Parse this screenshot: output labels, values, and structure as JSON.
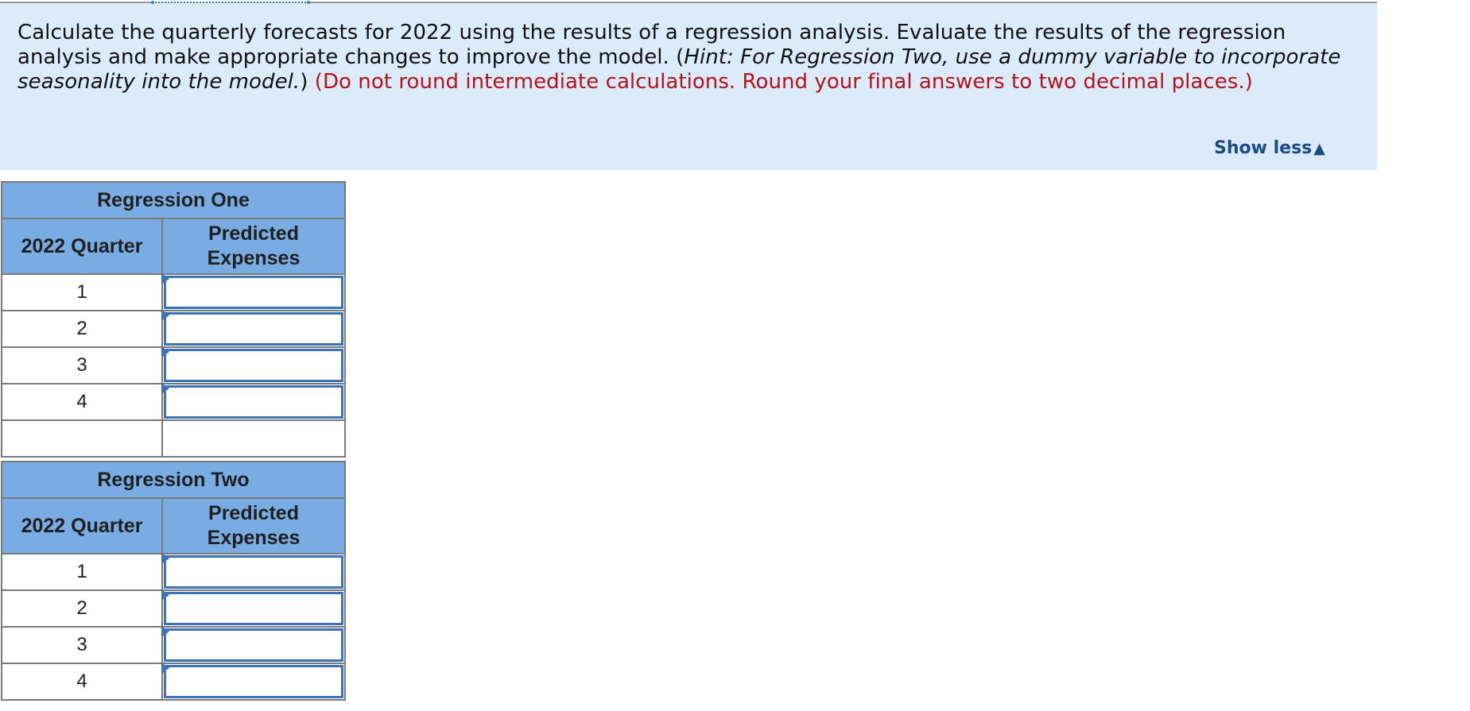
{
  "instructions": {
    "main_text": "Calculate the quarterly forecasts for 2022 using the results of a regression analysis. Evaluate the results of the regression analysis and make appropriate changes to improve the model. (",
    "hint_text": "Hint: For Regression Two, use a dummy variable to incorporate seasonality into the model.",
    "close_paren": ")",
    "rounding_note": "(Do not round intermediate calculations. Round your final answers to two decimal places.)",
    "show_less_label": "Show less",
    "show_less_icon": "triangle-up-icon",
    "accent_color": "#1b4a86",
    "note_color": "#b5121b",
    "panel_color": "#dbebfa"
  },
  "regression_one": {
    "title": "Regression One",
    "columns": [
      "2022 Quarter",
      "Predicted Expenses"
    ],
    "rows": [
      {
        "quarter": "1",
        "value": ""
      },
      {
        "quarter": "2",
        "value": ""
      },
      {
        "quarter": "3",
        "value": ""
      },
      {
        "quarter": "4",
        "value": ""
      }
    ],
    "header_color": "#79ace3"
  },
  "regression_two": {
    "title": "Regression Two",
    "columns": [
      "2022 Quarter",
      "Predicted Expenses"
    ],
    "rows": [
      {
        "quarter": "1",
        "value": ""
      },
      {
        "quarter": "2",
        "value": ""
      },
      {
        "quarter": "3",
        "value": ""
      },
      {
        "quarter": "4",
        "value": ""
      }
    ],
    "header_color": "#79ace3"
  }
}
